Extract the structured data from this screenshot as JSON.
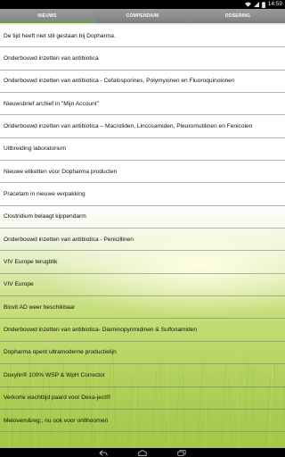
{
  "status_bar": {
    "time": "14:59"
  },
  "tabs": [
    {
      "label": "NIEUWS",
      "active": true
    },
    {
      "label": "COMPENDIUM",
      "active": false
    },
    {
      "label": "DOSERING",
      "active": false
    }
  ],
  "news_items": [
    "De tijd heeft niet stil gestaan bij Dopharma.",
    "Onderbouwd inzetten van antibiotica",
    "Onderbouwd inzetten van antibiotica - Cefalosporines, Polymyxinen en Fluoroquinolonen",
    "Nieuwsbrief archief in \"Mijn Account\"",
    "Onderbouwd inzetten van antibiotica – Macroliden, Lincosamiden, Pleuromutilinen en Fenicolen",
    "Uitbreiding laboratorium",
    "Nieuwe etiketten voor Dopharma producten",
    "Pracetam in nieuwe verpakking",
    "Clostridium belaagt kippendarm",
    "Onderbouwd inzetten van antibiotica - Penicillinen",
    "VIV Europe terugblik",
    "VIV Europe",
    "Biovit AD weer beschikbaar",
    "Onderbouwd inzetten van antibiotica- Diaminopyrimidinen & Sulfonamiden",
    "Dopharma opent ultramoderne productielijn",
    "Doxylin® 100% WSP & WpH Corrector",
    "Verkorte wachttijd paard voor Dexa-ject®",
    "Melovem&reg;, nu ook voor ontlhoornen"
  ],
  "colors": {
    "tab_indicator": "#6aa33a",
    "tab_background": "#8a8a8a",
    "text": "#111111"
  },
  "icons": [
    "wifi-icon",
    "signal-icon",
    "battery-icon",
    "back-icon",
    "home-icon",
    "recent-apps-icon"
  ]
}
